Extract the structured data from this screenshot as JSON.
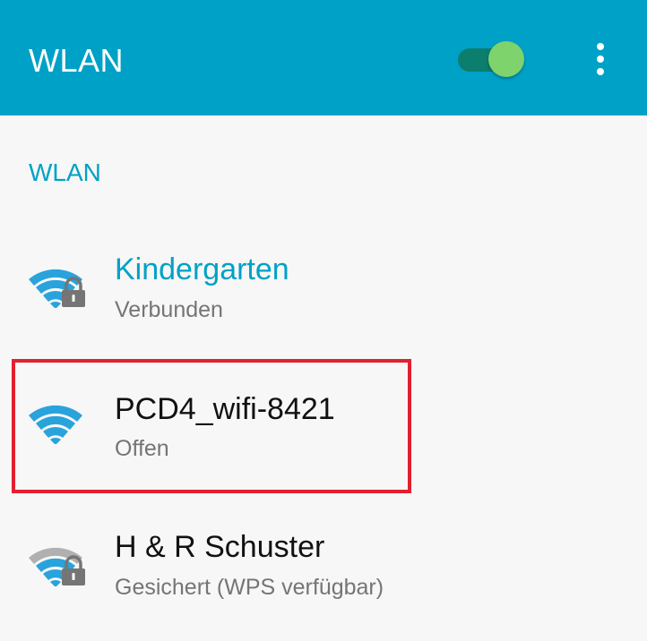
{
  "header": {
    "title": "WLAN",
    "wifi_toggle_on": true,
    "colors": {
      "bar": "#00a1c6",
      "toggle_track": "#0b7e6e",
      "toggle_thumb": "#7fd36c"
    },
    "menu_icon": "overflow-menu-icon"
  },
  "section": {
    "title": "WLAN"
  },
  "networks": [
    {
      "name": "Kindergarten",
      "status": "Verbunden",
      "secured": true,
      "connected": true,
      "signal_color": "#29a3dc",
      "name_color": "#00a1c6"
    },
    {
      "name": "PCD4_wifi-8421",
      "status": "Offen",
      "secured": false,
      "connected": false,
      "highlighted": true,
      "signal_color": "#29a3dc",
      "name_color": "#111111"
    },
    {
      "name": "H & R Schuster",
      "status": "Gesichert (WPS verfügbar)",
      "secured": true,
      "connected": false,
      "signal_color": "#29a3dc",
      "name_color": "#111111"
    }
  ],
  "highlight_color": "#e3202f"
}
